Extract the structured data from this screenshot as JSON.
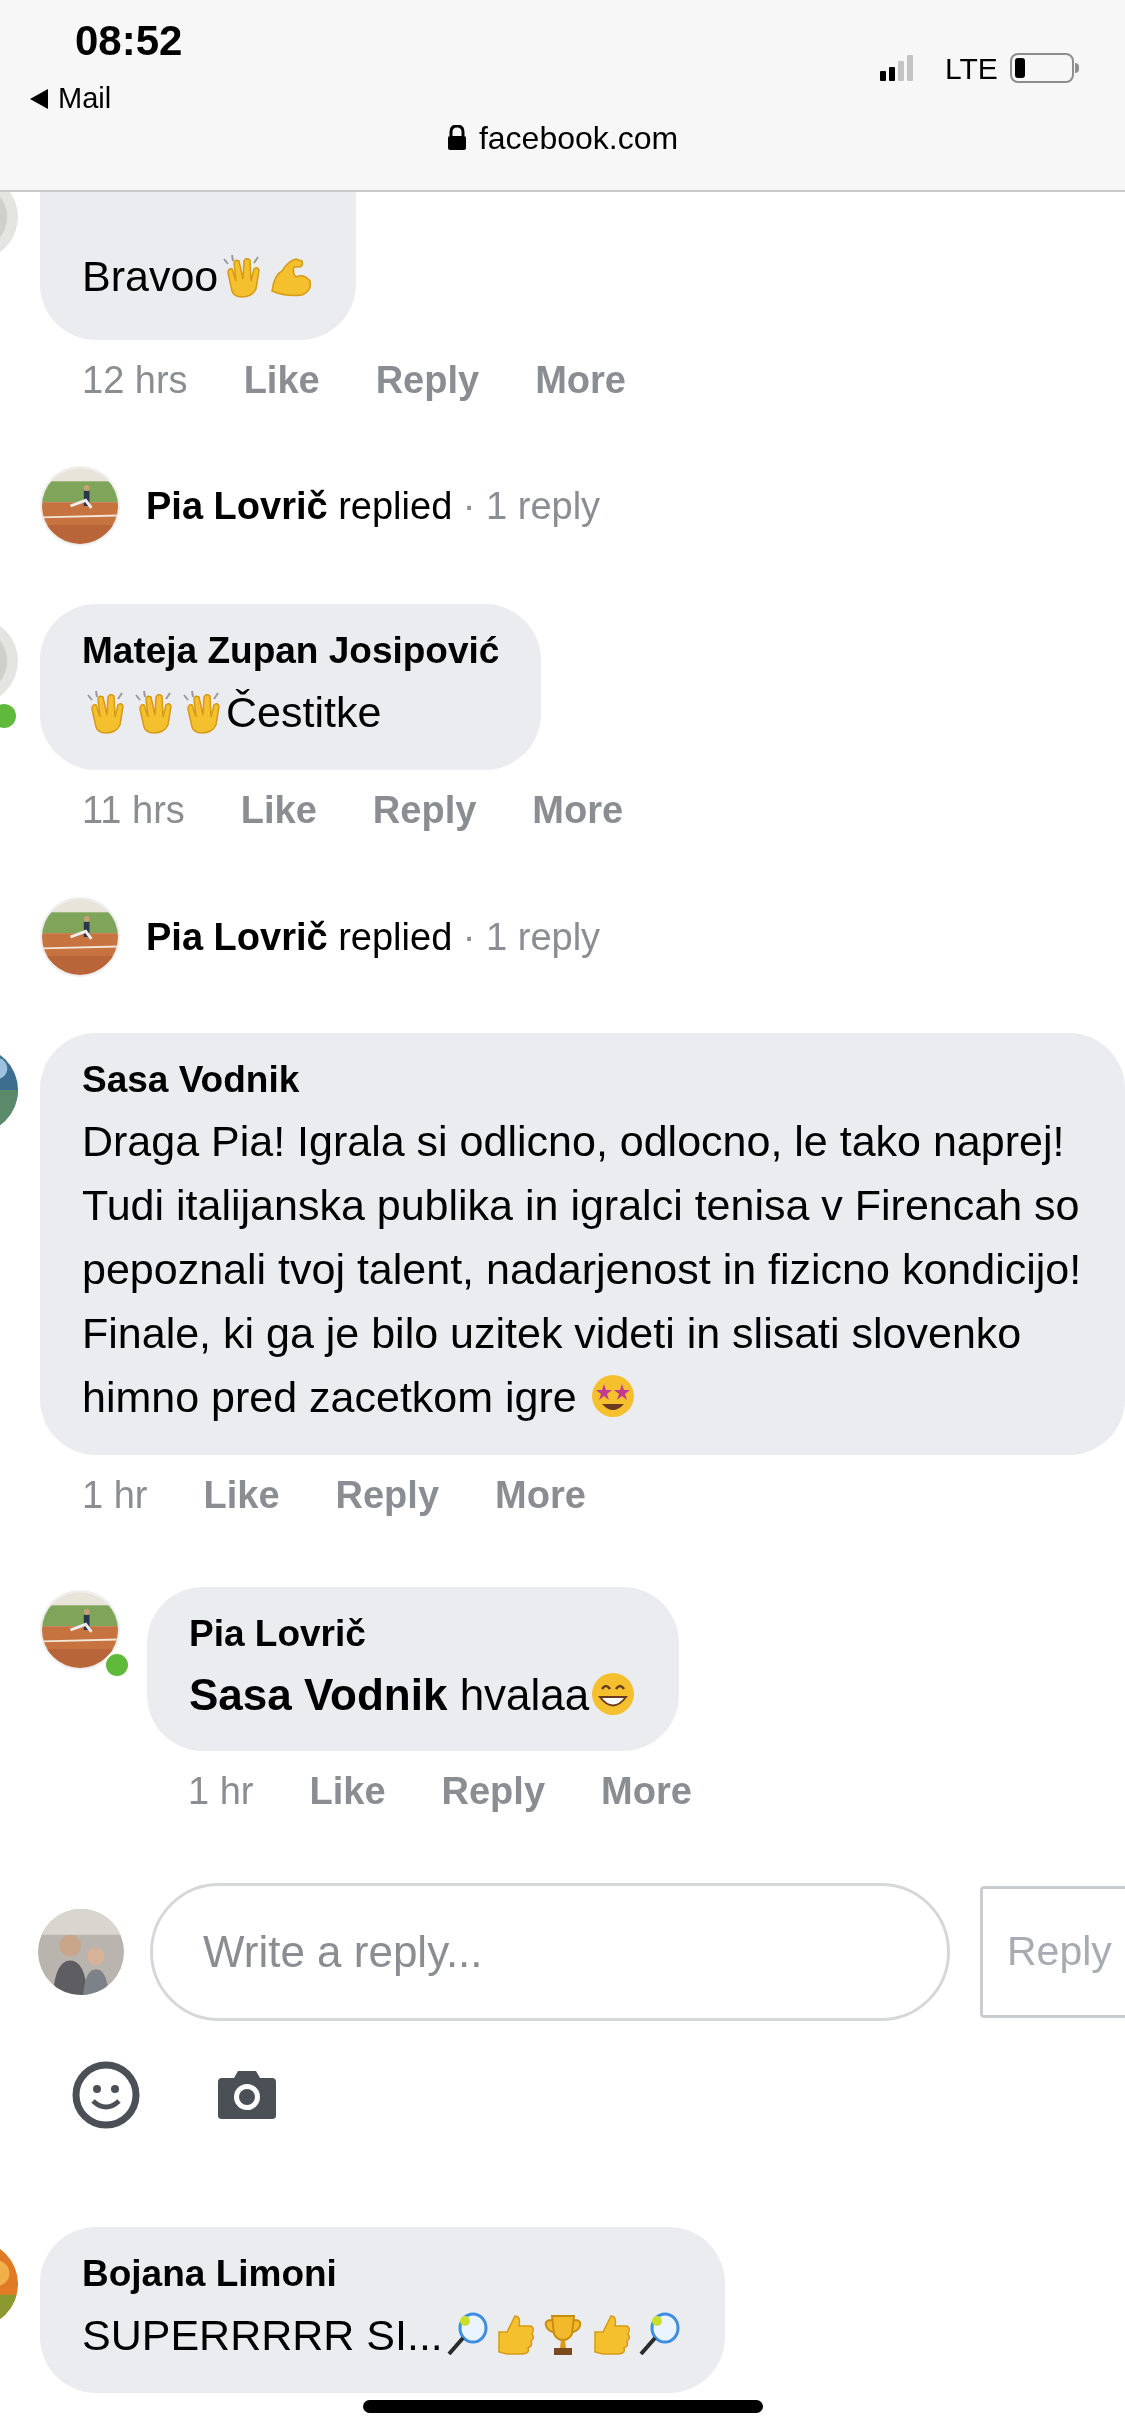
{
  "status_bar": {
    "time": "08:52",
    "back_label": "Mail",
    "url": "facebook.com",
    "network": "LTE"
  },
  "thread": [
    {
      "kind": "comment",
      "online": false,
      "body": [
        {
          "kind": "text",
          "text": "Bravoo"
        },
        {
          "kind": "clap"
        },
        {
          "kind": "muscle"
        }
      ],
      "meta": {
        "time": "12 hrs",
        "actions": [
          "Like",
          "Reply",
          "More"
        ]
      }
    },
    {
      "kind": "replies",
      "author": "Pia Lovrič",
      "verb": "replied",
      "count": "· 1 reply"
    },
    {
      "kind": "comment",
      "author": "Mateja Zupan Josipović",
      "online": true,
      "body": [
        {
          "kind": "clap"
        },
        {
          "kind": "clap"
        },
        {
          "kind": "clap"
        },
        {
          "kind": "text",
          "text": "Čestitke"
        }
      ],
      "meta": {
        "time": "11 hrs",
        "actions": [
          "Like",
          "Reply",
          "More"
        ]
      }
    },
    {
      "kind": "replies",
      "author": "Pia Lovrič",
      "verb": "replied",
      "count": "· 1 reply"
    },
    {
      "kind": "comment",
      "author": "Sasa Vodnik",
      "online": false,
      "body": [
        {
          "kind": "text",
          "text": "Draga Pia! Igrala si odlicno, odlocno, le tako naprej! Tudi italijanska publika in igralci tenisa v Firencah so pepoznali tvoj talent, nadarjenost in fizicno kondicijo! Finale, ki ga je bilo uzitek videti in slisati slovenko himno pred zacetkom igre "
        },
        {
          "kind": "starstruck"
        }
      ],
      "meta": {
        "time": "1 hr",
        "actions": [
          "Like",
          "Reply",
          "More"
        ]
      }
    },
    {
      "kind": "reply",
      "author": "Pia Lovrič",
      "online": true,
      "body": [
        {
          "kind": "text",
          "text": "**Sasa Vodnik** hvalaa"
        },
        {
          "kind": "grin"
        }
      ],
      "meta": {
        "time": "1 hr",
        "actions": [
          "Like",
          "Reply",
          "More"
        ]
      }
    },
    {
      "kind": "composer",
      "placeholder": "Write a reply...",
      "button": "Reply"
    },
    {
      "kind": "comment",
      "author": "Bojana Limoni",
      "online": false,
      "body": [
        {
          "kind": "text",
          "text": "SUPERRRRR SI..."
        },
        {
          "kind": "racket"
        },
        {
          "kind": "thumb"
        },
        {
          "kind": "trophy"
        },
        {
          "kind": "thumb"
        },
        {
          "kind": "racket"
        }
      ]
    }
  ]
}
